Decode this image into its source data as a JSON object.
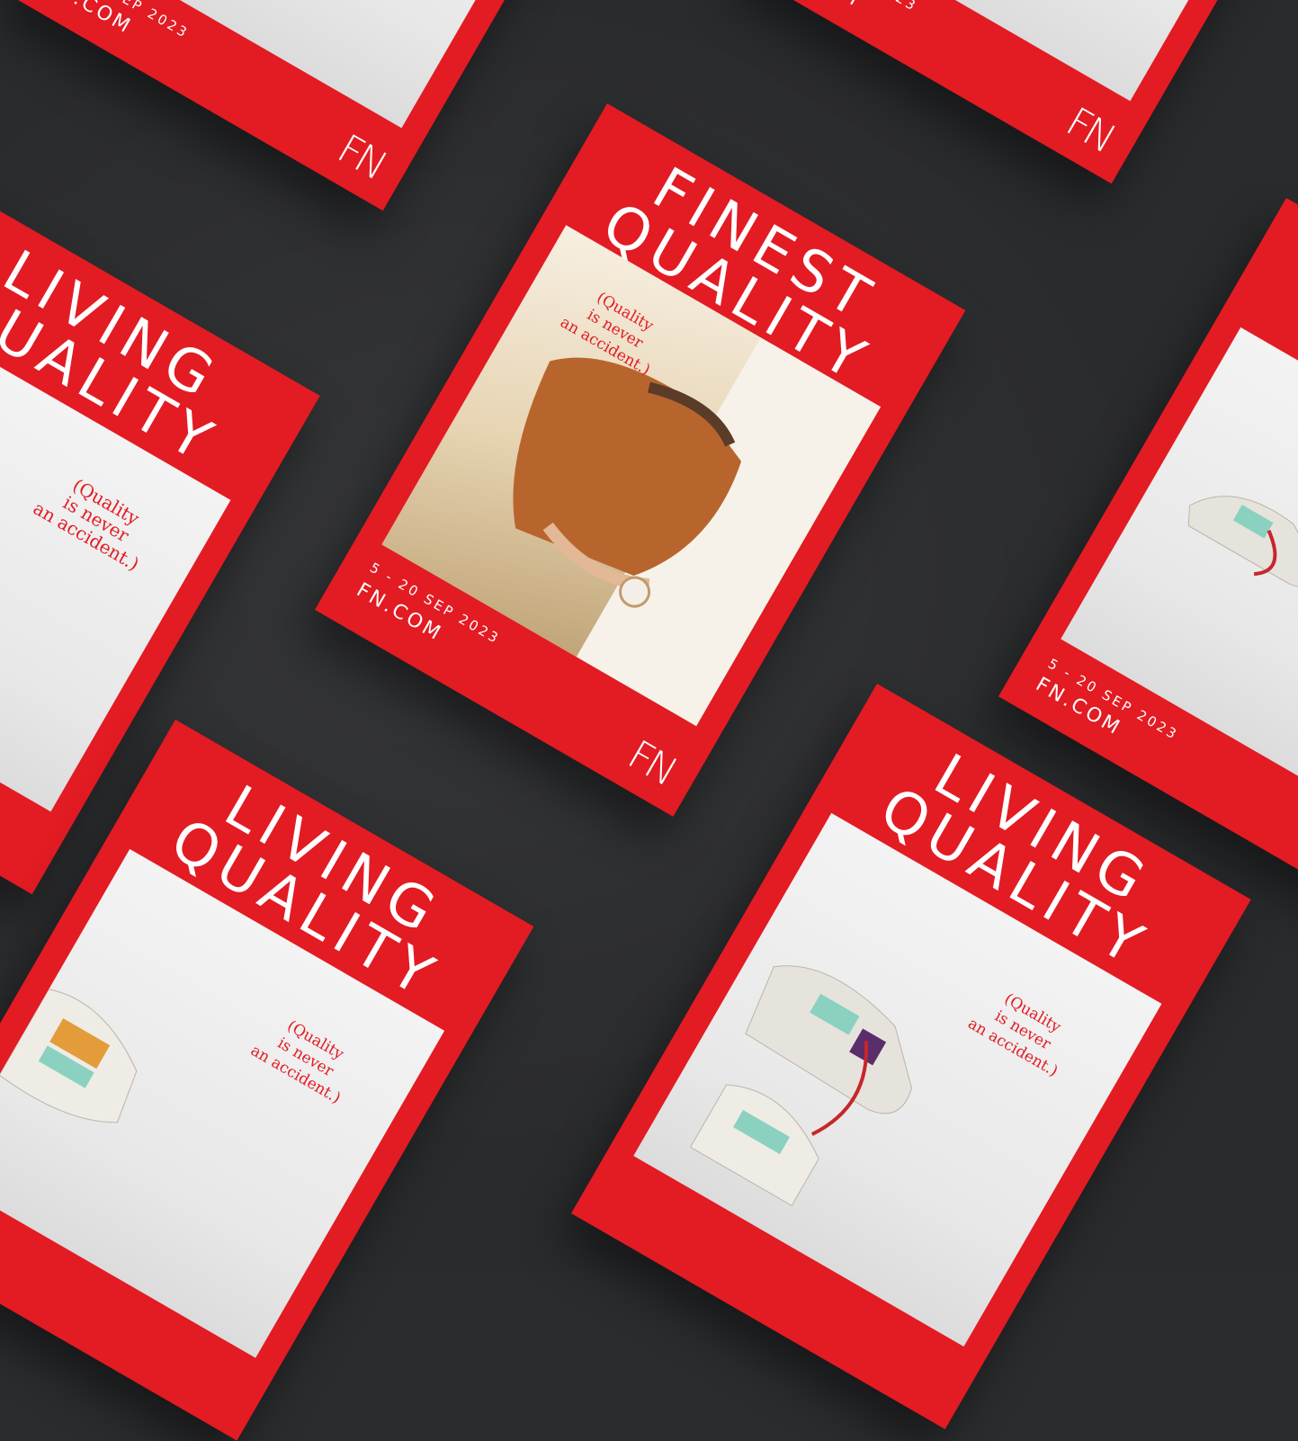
{
  "colors": {
    "accent": "#e31b23",
    "background": "#2a2b2d",
    "paper": "#f1f1f1"
  },
  "posters": [
    {
      "headline": "FINEST\nQUALITY",
      "tagline": "(Quality\nis never\nan accident.)",
      "date": "5 - 20 SEP 2023",
      "site": "FN.COM",
      "logo": "FN",
      "image": "handbag-photo"
    },
    {
      "headline": "LIVING\nQUALITY",
      "tagline": "(Quality\nis never\nan accident.)",
      "date": "5 - 20 SEP 2023",
      "site": "FN.COM",
      "logo": "FN",
      "image": "sneaker-photo"
    }
  ]
}
